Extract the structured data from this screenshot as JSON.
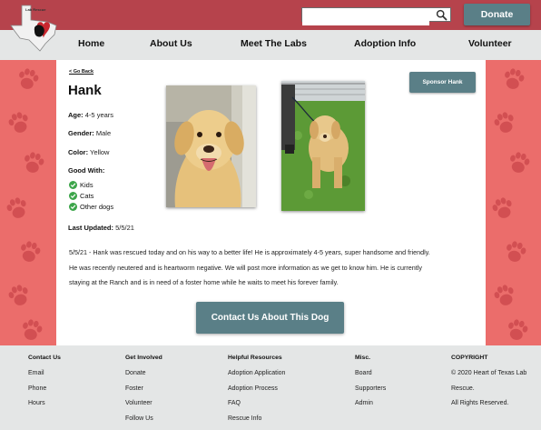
{
  "header": {
    "logo_icon": "texas-heart-dog-logo",
    "logo_text": "Lab Rescue",
    "search": {
      "value": "",
      "placeholder": "",
      "icon": "search-icon"
    },
    "donate_label": "Donate",
    "color_bar": "#b6434c"
  },
  "nav": {
    "items": [
      "Home",
      "About Us",
      "Meet The Labs",
      "Adoption Info",
      "Volunteer"
    ]
  },
  "dog": {
    "back_label": "< Go Back",
    "name": "Hank",
    "age_label": "Age:",
    "age": "4-5 years",
    "gender_label": "Gender:",
    "gender": "Male",
    "color_label": "Color:",
    "color": "Yellow",
    "good_with_label": "Good With:",
    "good_with": [
      "Kids",
      "Cats",
      "Other dogs"
    ],
    "last_updated_label": "Last Updated:",
    "last_updated": "5/5/21",
    "sponsor_label": "Sponsor Hank",
    "description_lines": [
      "5/5/21 - Hank was rescued today and on his way to a better life! He is approximately 4-5 years, super handsome and friendly.",
      "He was recently neutered and is heartworm negative. We will post more information as we get to know him. He is currently",
      "staying at the Ranch and is in need of a foster home while he waits to meet his forever family."
    ],
    "contact_label": "Contact Us About This Dog"
  },
  "footer": {
    "columns": [
      {
        "title": "Contact Us",
        "links": [
          "Email",
          "Phone",
          "Hours"
        ]
      },
      {
        "title": "Get Involved",
        "links": [
          "Donate",
          "Foster",
          "Volunteer",
          "Follow Us"
        ]
      },
      {
        "title": "Helpful Resources",
        "links": [
          "Adoption Application",
          "Adoption Process",
          "FAQ",
          "Rescue Info"
        ]
      },
      {
        "title": "Misc.",
        "links": [
          "Board",
          "Supporters",
          "Admin"
        ]
      },
      {
        "title": "COPYRIGHT",
        "links": [
          "© 2020 Heart of Texas Lab",
          "Rescue.",
          "All Rights Reserved."
        ]
      }
    ]
  },
  "colors": {
    "accent": "#b6434c",
    "button": "#5a7f87",
    "side_panels": "#eb6d6b",
    "nav_bg": "#e4e6e6",
    "check": "#3ca54a"
  }
}
